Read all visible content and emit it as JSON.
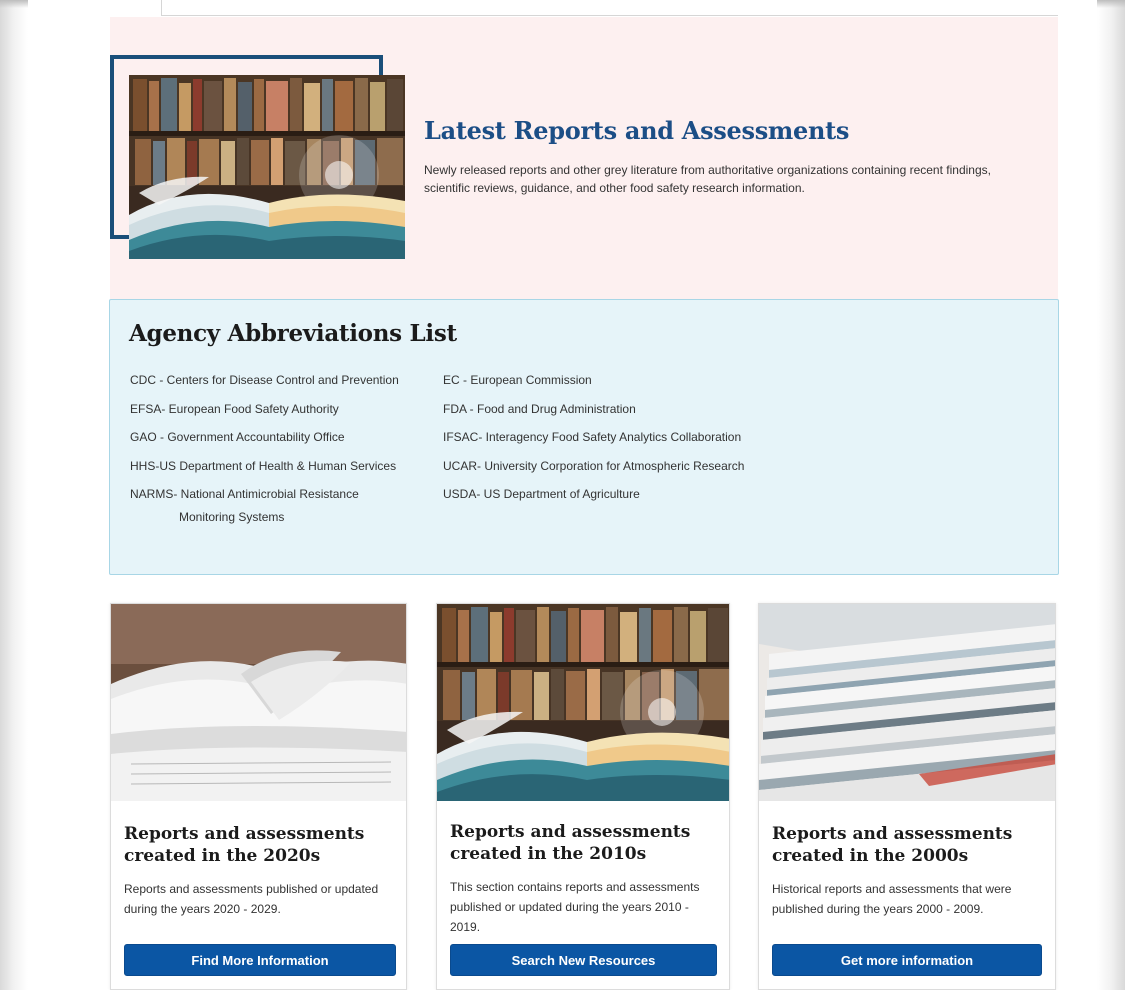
{
  "hero": {
    "title": "Latest Reports and Assessments",
    "description": "Newly released reports and other grey literature from authoritative organizations containing recent findings, scientific reviews, guidance, and other food safety research information."
  },
  "abbreviations": {
    "title": "Agency Abbreviations List",
    "left": [
      "CDC - Centers for Disease Control and Prevention",
      "EFSA- European Food Safety Authority",
      "GAO - Government Accountability Office",
      "HHS-US Department of Health & Human Services",
      "NARMS- National Antimicrobial Resistance",
      "Monitoring Systems"
    ],
    "right": [
      "EC - European Commission",
      "FDA - Food and Drug Administration",
      "IFSAC- Interagency Food Safety Analytics Collaboration",
      "UCAR- University Corporation for Atmospheric Research",
      "USDA- US Department of Agriculture"
    ]
  },
  "cards": [
    {
      "title": "Reports and assessments created in the 2020s",
      "body": "Reports and assessments published or updated during the years 2020 - 2029.",
      "button": "Find More Information"
    },
    {
      "title": "Reports and assessments created in the 2010s",
      "body": "This section contains reports and assessments published or updated during the years 2010 - 2019.",
      "button": "Search New Resources"
    },
    {
      "title": "Reports and assessments created in the 2000s",
      "body": "Historical reports and assessments that were published during the years 2000 - 2009.",
      "button": "Get more information"
    }
  ],
  "colors": {
    "hero_background": "#fdf0f0",
    "abbr_background": "#e6f4f9",
    "button": "#0b56a4",
    "heading_blue": "#1c4e86",
    "frame_navy": "#1a4f7a"
  }
}
